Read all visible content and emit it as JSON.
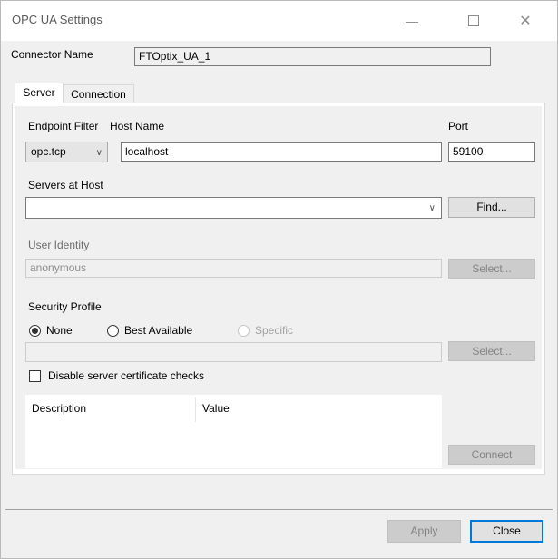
{
  "window": {
    "title": "OPC UA Settings",
    "minimize_icon": "minimize-icon",
    "maximize_icon": "maximize-icon",
    "close_icon": "close-icon"
  },
  "connector": {
    "label": "Connector Name",
    "value": "FTOptix_UA_1"
  },
  "tabs": [
    {
      "label": "Server",
      "selected": true
    },
    {
      "label": "Connection",
      "selected": false
    }
  ],
  "server": {
    "endpoint_filter_label": "Endpoint Filter",
    "endpoint_filter_value": "opc.tcp",
    "host_name_label": "Host Name",
    "host_name_value": "localhost",
    "port_label": "Port",
    "port_value": "59100",
    "servers_at_host_label": "Servers at Host",
    "servers_at_host_value": "",
    "find_button": "Find...",
    "user_identity_label": "User Identity",
    "user_identity_value": "anonymous",
    "user_select_button": "Select...",
    "security_profile_label": "Security Profile",
    "radio_none": "None",
    "radio_best": "Best Available",
    "radio_specific": "Specific",
    "security_value": "",
    "security_select_button": "Select...",
    "disable_cert_label": "Disable server certificate checks",
    "table_headers": [
      "Description",
      "Value"
    ],
    "connect_button": "Connect"
  },
  "footer": {
    "apply_button": "Apply",
    "close_button": "Close"
  },
  "colors": {
    "accent": "#0078d7",
    "dialog_bg": "#f0f0f0"
  }
}
